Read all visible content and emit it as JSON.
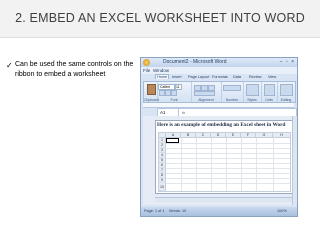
{
  "slide": {
    "title": "2. EMBED AN EXCEL WORKSHEET INTO WORD",
    "bullet_icon": "checkmark-icon",
    "bullet_glyph": "✓",
    "bullet_text": "Can be used the same controls on the ribbon to embed a worksheet"
  },
  "word": {
    "window_title": "Document2 - Microsoft Word",
    "window_controls": "– ▫ ×",
    "menu": [
      "File",
      "Window"
    ],
    "ribbon_tabs": [
      "Home",
      "Insert",
      "Page Layout",
      "Formulas",
      "Data",
      "Review",
      "View"
    ],
    "font_name": "Calibri",
    "font_size": "11",
    "groups": {
      "clipboard": "Clipboard",
      "font": "Font",
      "alignment": "Alignment",
      "number": "Number",
      "styles": "Styles",
      "cells": "Cells",
      "editing": "Editing"
    },
    "name_box": "A1",
    "fx": "fx",
    "doc_heading": "Here is an example of embedding an Excel sheet in Word",
    "columns": [
      "A",
      "B",
      "C",
      "D",
      "E",
      "F",
      "G",
      "H"
    ],
    "rows": [
      "1",
      "2",
      "3",
      "4",
      "5",
      "6",
      "7",
      "8",
      "9",
      "10"
    ],
    "status": {
      "page": "Page: 1 of 1",
      "words": "Words: 10",
      "zoom": "100%"
    }
  }
}
